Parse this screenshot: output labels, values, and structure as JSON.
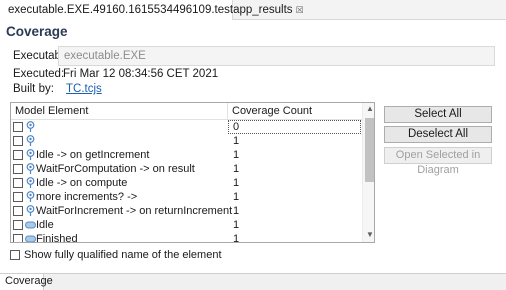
{
  "editor_tab": {
    "title": "executable.EXE.49160.1615534496109.testapp_results",
    "close": "☒"
  },
  "page_title": "Coverage",
  "fields": {
    "executable_label": "Executable:",
    "executable_value": "executable.EXE",
    "executed_label": "Executed:",
    "executed_value": "Fri Mar 12 08:34:56 CET 2021",
    "built_by_label": "Built by:",
    "built_by_value": "TC.tcjs"
  },
  "table": {
    "columns": [
      "Model Element",
      "Coverage Count"
    ],
    "rows": [
      {
        "icon": "state-machine-icon",
        "label": "",
        "count": "0"
      },
      {
        "icon": "state-machine-icon",
        "label": "",
        "count": "1"
      },
      {
        "icon": "state-machine-icon",
        "label": "Idle ->  on getIncrement",
        "count": "1"
      },
      {
        "icon": "state-machine-icon",
        "label": "WaitForComputation ->  on result",
        "count": "1"
      },
      {
        "icon": "state-machine-icon",
        "label": "Idle ->  on compute",
        "count": "1"
      },
      {
        "icon": "state-machine-icon",
        "label": "more increments? ->",
        "count": "1"
      },
      {
        "icon": "state-machine-icon",
        "label": "WaitForIncrement ->  on returnIncrement",
        "count": "1"
      },
      {
        "icon": "state-icon",
        "label": "Idle",
        "count": "1"
      },
      {
        "icon": "state-icon",
        "label": "Finished",
        "count": "1"
      }
    ]
  },
  "buttons": {
    "select_all": "Select All",
    "deselect_all": "Deselect All",
    "open_selected": "Open Selected in Diagram"
  },
  "show_fq_label": "Show fully qualified name of the element",
  "bottom_tab": "Coverage",
  "colors": {
    "accent": "#2b3b52",
    "link": "#1a5fb4",
    "state_icon": "#5a8fc4"
  }
}
